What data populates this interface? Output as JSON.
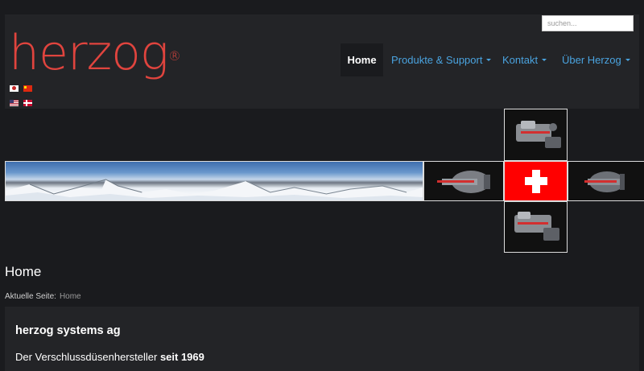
{
  "search": {
    "placeholder": "suchen..."
  },
  "logo": {
    "text": "herzog",
    "mark": "®"
  },
  "languages": [
    {
      "name": "japan-flag-icon"
    },
    {
      "name": "china-flag-icon"
    },
    {
      "name": "usa-flag-icon"
    },
    {
      "name": "denmark-flag-icon"
    }
  ],
  "nav": {
    "home": "Home",
    "produkte": "Produkte & Support",
    "kontakt": "Kontakt",
    "ueber": "Über Herzog"
  },
  "colors": {
    "brand": "#e0443e",
    "link": "#4aa3df",
    "background": "#1a1b1e",
    "panel": "#232427",
    "swiss_red": "#ff0000"
  },
  "page": {
    "title": "Home"
  },
  "breadcrumb": {
    "label": "Aktuelle Seite:",
    "current": "Home"
  },
  "content": {
    "heading": "herzog systems ag",
    "tagline_prefix": "Der Verschlussdüsenhersteller",
    "tagline_bold": "seit 1969"
  }
}
